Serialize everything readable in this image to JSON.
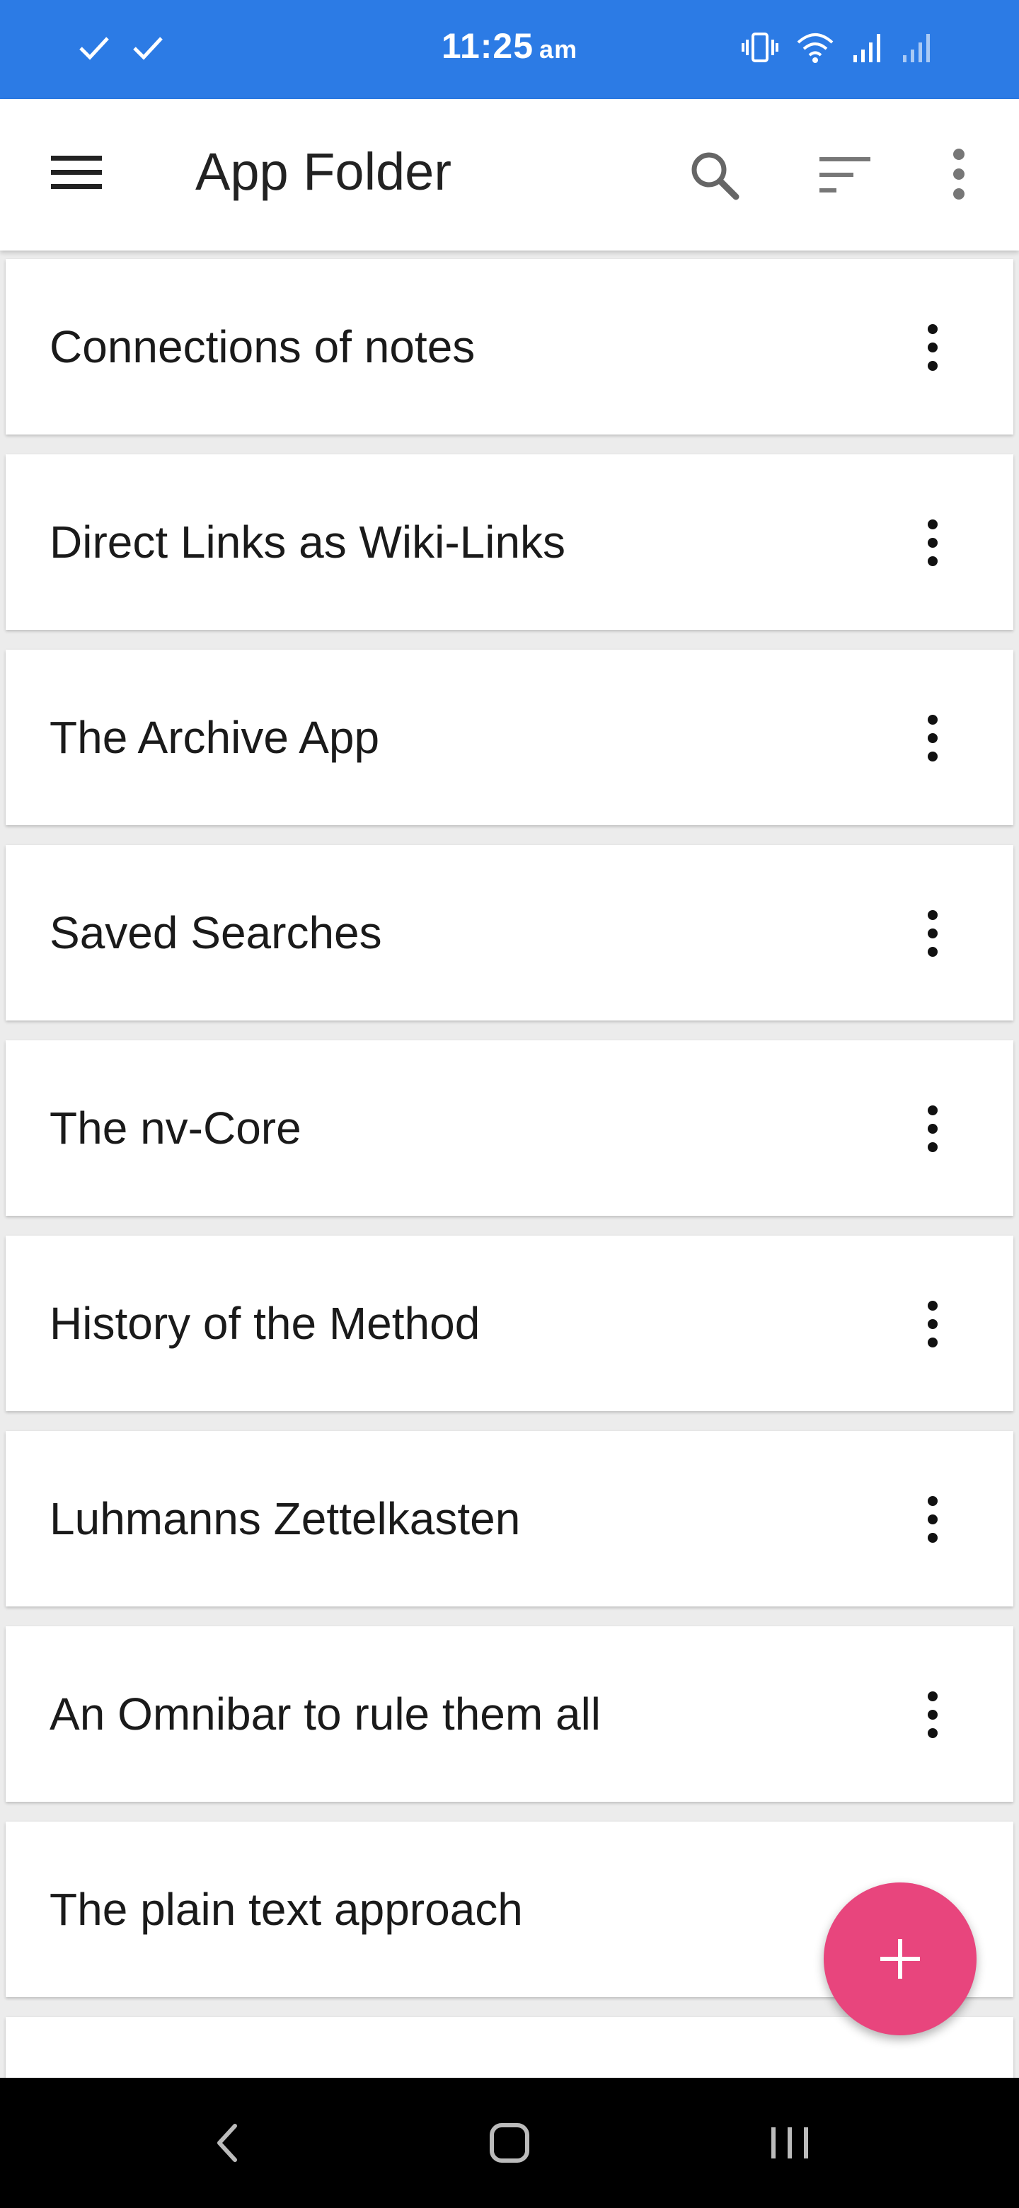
{
  "status_bar": {
    "time": "11:25",
    "ampm": "am",
    "icons": [
      "check-icon",
      "check-icon",
      "vibrate-icon",
      "wifi-icon",
      "signal-icon",
      "signal-icon"
    ],
    "background": "#2c7be5"
  },
  "app_bar": {
    "title": "App Folder",
    "icons": [
      "menu-icon",
      "search-icon",
      "sort-icon",
      "more-vert-icon"
    ]
  },
  "notes": [
    {
      "title": "Connections of notes"
    },
    {
      "title": "Direct Links as Wiki-Links"
    },
    {
      "title": "The Archive App"
    },
    {
      "title": "Saved Searches"
    },
    {
      "title": "The nv-Core"
    },
    {
      "title": "History of the Method"
    },
    {
      "title": "Luhmanns Zettelkasten"
    },
    {
      "title": "An Omnibar to rule them all"
    },
    {
      "title": "The plain text approach"
    },
    {
      "title": ""
    }
  ],
  "fab": {
    "icon": "plus-icon",
    "color": "#e8457d"
  },
  "nav_bar": {
    "icons": [
      "back-icon",
      "home-icon",
      "recents-icon"
    ]
  }
}
